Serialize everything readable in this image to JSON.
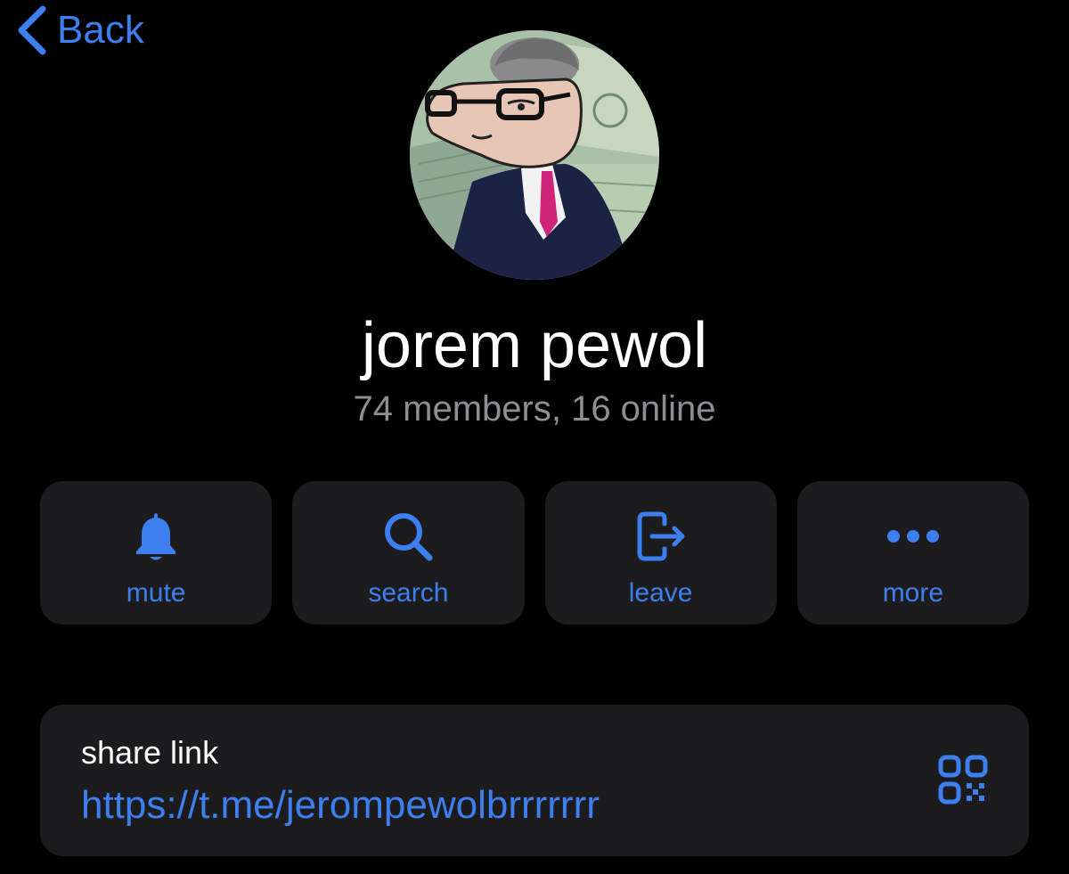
{
  "nav": {
    "back_label": "Back",
    "back_icon": "chevron-left-icon"
  },
  "profile": {
    "name": "jorem pewol",
    "subtitle": "74 members, 16 online",
    "avatar_icon": "group-avatar"
  },
  "actions": [
    {
      "label": "mute",
      "icon": "bell-icon"
    },
    {
      "label": "search",
      "icon": "search-icon"
    },
    {
      "label": "leave",
      "icon": "leave-icon"
    },
    {
      "label": "more",
      "icon": "more-icon"
    }
  ],
  "share": {
    "title": "share link",
    "url": "https://t.me/jerompewolbrrrrrrr",
    "icon": "qr-code-icon"
  },
  "colors": {
    "accent": "#3e7ff0",
    "background": "#000000",
    "card": "#1c1c1e",
    "secondary_text": "#8e8e93"
  }
}
